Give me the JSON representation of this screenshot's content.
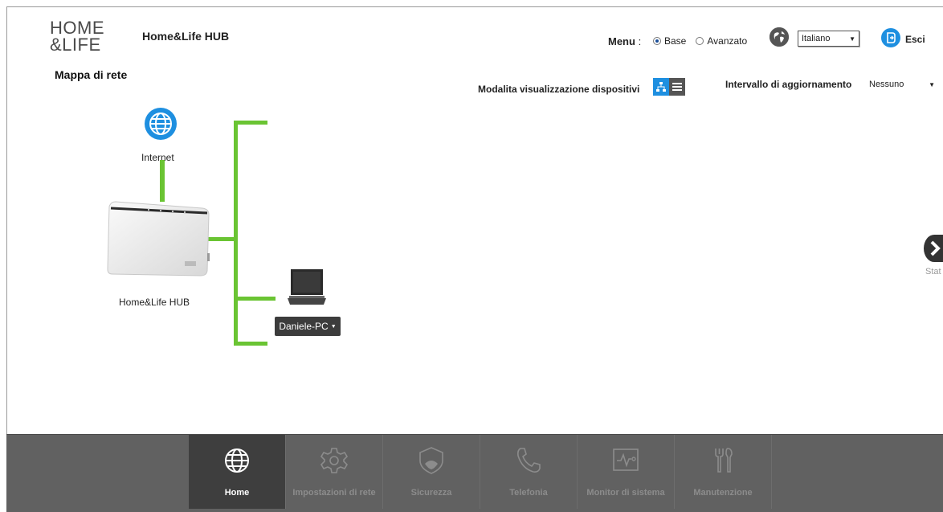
{
  "header": {
    "logo_line1": "HOME",
    "logo_line2": "&LIFE",
    "app_title": "Home&Life HUB",
    "page_title": "Mappa di rete",
    "menu_label": "Menu",
    "menu_sep": ":",
    "menu_options": [
      "Base",
      "Avanzato"
    ],
    "menu_selected": "Base",
    "language": "Italiano",
    "logout_label": "Esci",
    "view_mode_label": "Modalita visualizzazione dispositivi",
    "interval_label": "Intervallo di aggiornamento",
    "interval_value": "Nessuno"
  },
  "map": {
    "internet_label": "Internet",
    "router_label": "Home&Life HUB",
    "device_label": "Daniele-PC",
    "side_panel_label": "Stat"
  },
  "nav": {
    "items": [
      {
        "label": "Home",
        "icon": "globe-icon",
        "active": true
      },
      {
        "label": "Impostazioni di rete",
        "icon": "gear-icon",
        "active": false
      },
      {
        "label": "Sicurezza",
        "icon": "shield-icon",
        "active": false
      },
      {
        "label": "Telefonia",
        "icon": "phone-icon",
        "active": false
      },
      {
        "label": "Monitor di sistema",
        "icon": "monitor-icon",
        "active": false
      },
      {
        "label": "Manutenzione",
        "icon": "tools-icon",
        "active": false
      }
    ]
  },
  "colors": {
    "accent_blue": "#1e8fe0",
    "link_green": "#6ac433",
    "nav_bg": "#616161",
    "nav_active": "#3e3e3e"
  }
}
